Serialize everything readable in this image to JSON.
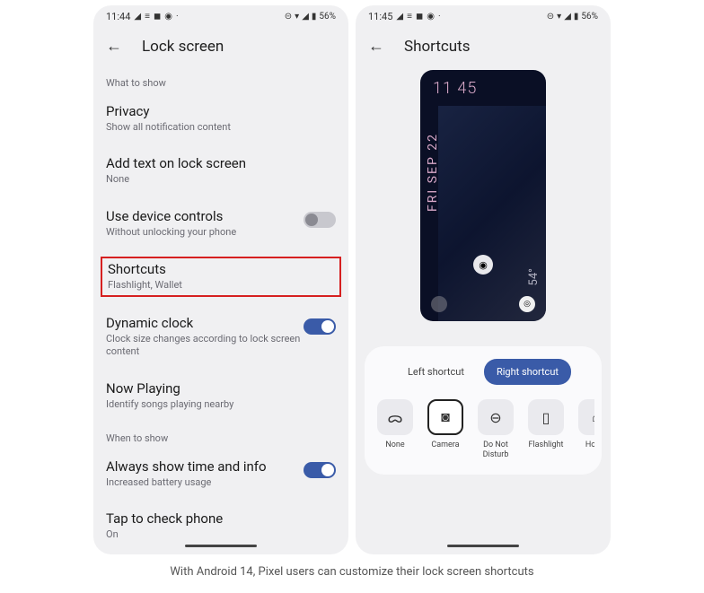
{
  "left": {
    "statusbar": {
      "time": "11:44",
      "battery": "56%"
    },
    "title": "Lock screen",
    "sections": {
      "what_to_show": "What to show",
      "when_to_show": "When to show"
    },
    "items": {
      "privacy": {
        "title": "Privacy",
        "sub": "Show all notification content"
      },
      "addtext": {
        "title": "Add text on lock screen",
        "sub": "None"
      },
      "devcontrols": {
        "title": "Use device controls",
        "sub": "Without unlocking your phone"
      },
      "shortcuts": {
        "title": "Shortcuts",
        "sub": "Flashlight, Wallet"
      },
      "dynclock": {
        "title": "Dynamic clock",
        "sub": "Clock size changes according to lock screen content"
      },
      "nowplaying": {
        "title": "Now Playing",
        "sub": "Identify songs playing nearby"
      },
      "alwaysshow": {
        "title": "Always show time and info",
        "sub": "Increased battery usage"
      },
      "tapcheck": {
        "title": "Tap to check phone",
        "sub": "On"
      }
    }
  },
  "right": {
    "statusbar": {
      "time": "11:45",
      "battery": "56%"
    },
    "title": "Shortcuts",
    "preview": {
      "time": "11 45",
      "date": "FRI SEP 22",
      "temp": "54°"
    },
    "tabs": {
      "left": "Left shortcut",
      "right": "Right shortcut"
    },
    "shortcuts": {
      "none": "None",
      "camera": "Camera",
      "dnd": "Do Not Disturb",
      "flashlight": "Flashlight",
      "home": "Home"
    }
  },
  "caption": "With Android 14, Pixel users can customize their lock screen shortcuts"
}
